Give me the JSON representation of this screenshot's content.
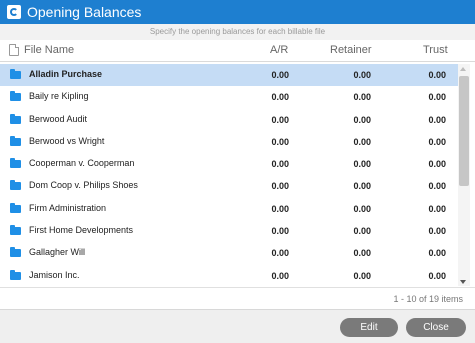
{
  "window": {
    "title": "Opening Balances"
  },
  "subtitle": "Specify the opening balances for each billable file",
  "columns": {
    "file_name": "File Name",
    "ar": "A/R",
    "retainer": "Retainer",
    "trust": "Trust"
  },
  "rows": [
    {
      "name": "Alladin Purchase",
      "ar": "0.00",
      "retainer": "0.00",
      "trust": "0.00",
      "selected": true
    },
    {
      "name": "Baily re Kipling",
      "ar": "0.00",
      "retainer": "0.00",
      "trust": "0.00"
    },
    {
      "name": "Berwood Audit",
      "ar": "0.00",
      "retainer": "0.00",
      "trust": "0.00"
    },
    {
      "name": "Berwood vs Wright",
      "ar": "0.00",
      "retainer": "0.00",
      "trust": "0.00"
    },
    {
      "name": "Cooperman v. Cooperman",
      "ar": "0.00",
      "retainer": "0.00",
      "trust": "0.00"
    },
    {
      "name": "Dom Coop v. Philips Shoes",
      "ar": "0.00",
      "retainer": "0.00",
      "trust": "0.00"
    },
    {
      "name": "Firm Administration",
      "ar": "0.00",
      "retainer": "0.00",
      "trust": "0.00"
    },
    {
      "name": "First Home Developments",
      "ar": "0.00",
      "retainer": "0.00",
      "trust": "0.00"
    },
    {
      "name": "Gallagher Will",
      "ar": "0.00",
      "retainer": "0.00",
      "trust": "0.00"
    },
    {
      "name": "Jamison Inc.",
      "ar": "0.00",
      "retainer": "0.00",
      "trust": "0.00"
    }
  ],
  "pager": {
    "text": "1 - 10 of 19 items"
  },
  "buttons": {
    "edit": "Edit",
    "close": "Close"
  },
  "colors": {
    "titlebar": "#1e7fd0",
    "folder": "#1f8fe6",
    "selected_row": "#c5dcf5",
    "button": "#7a7a7a"
  }
}
